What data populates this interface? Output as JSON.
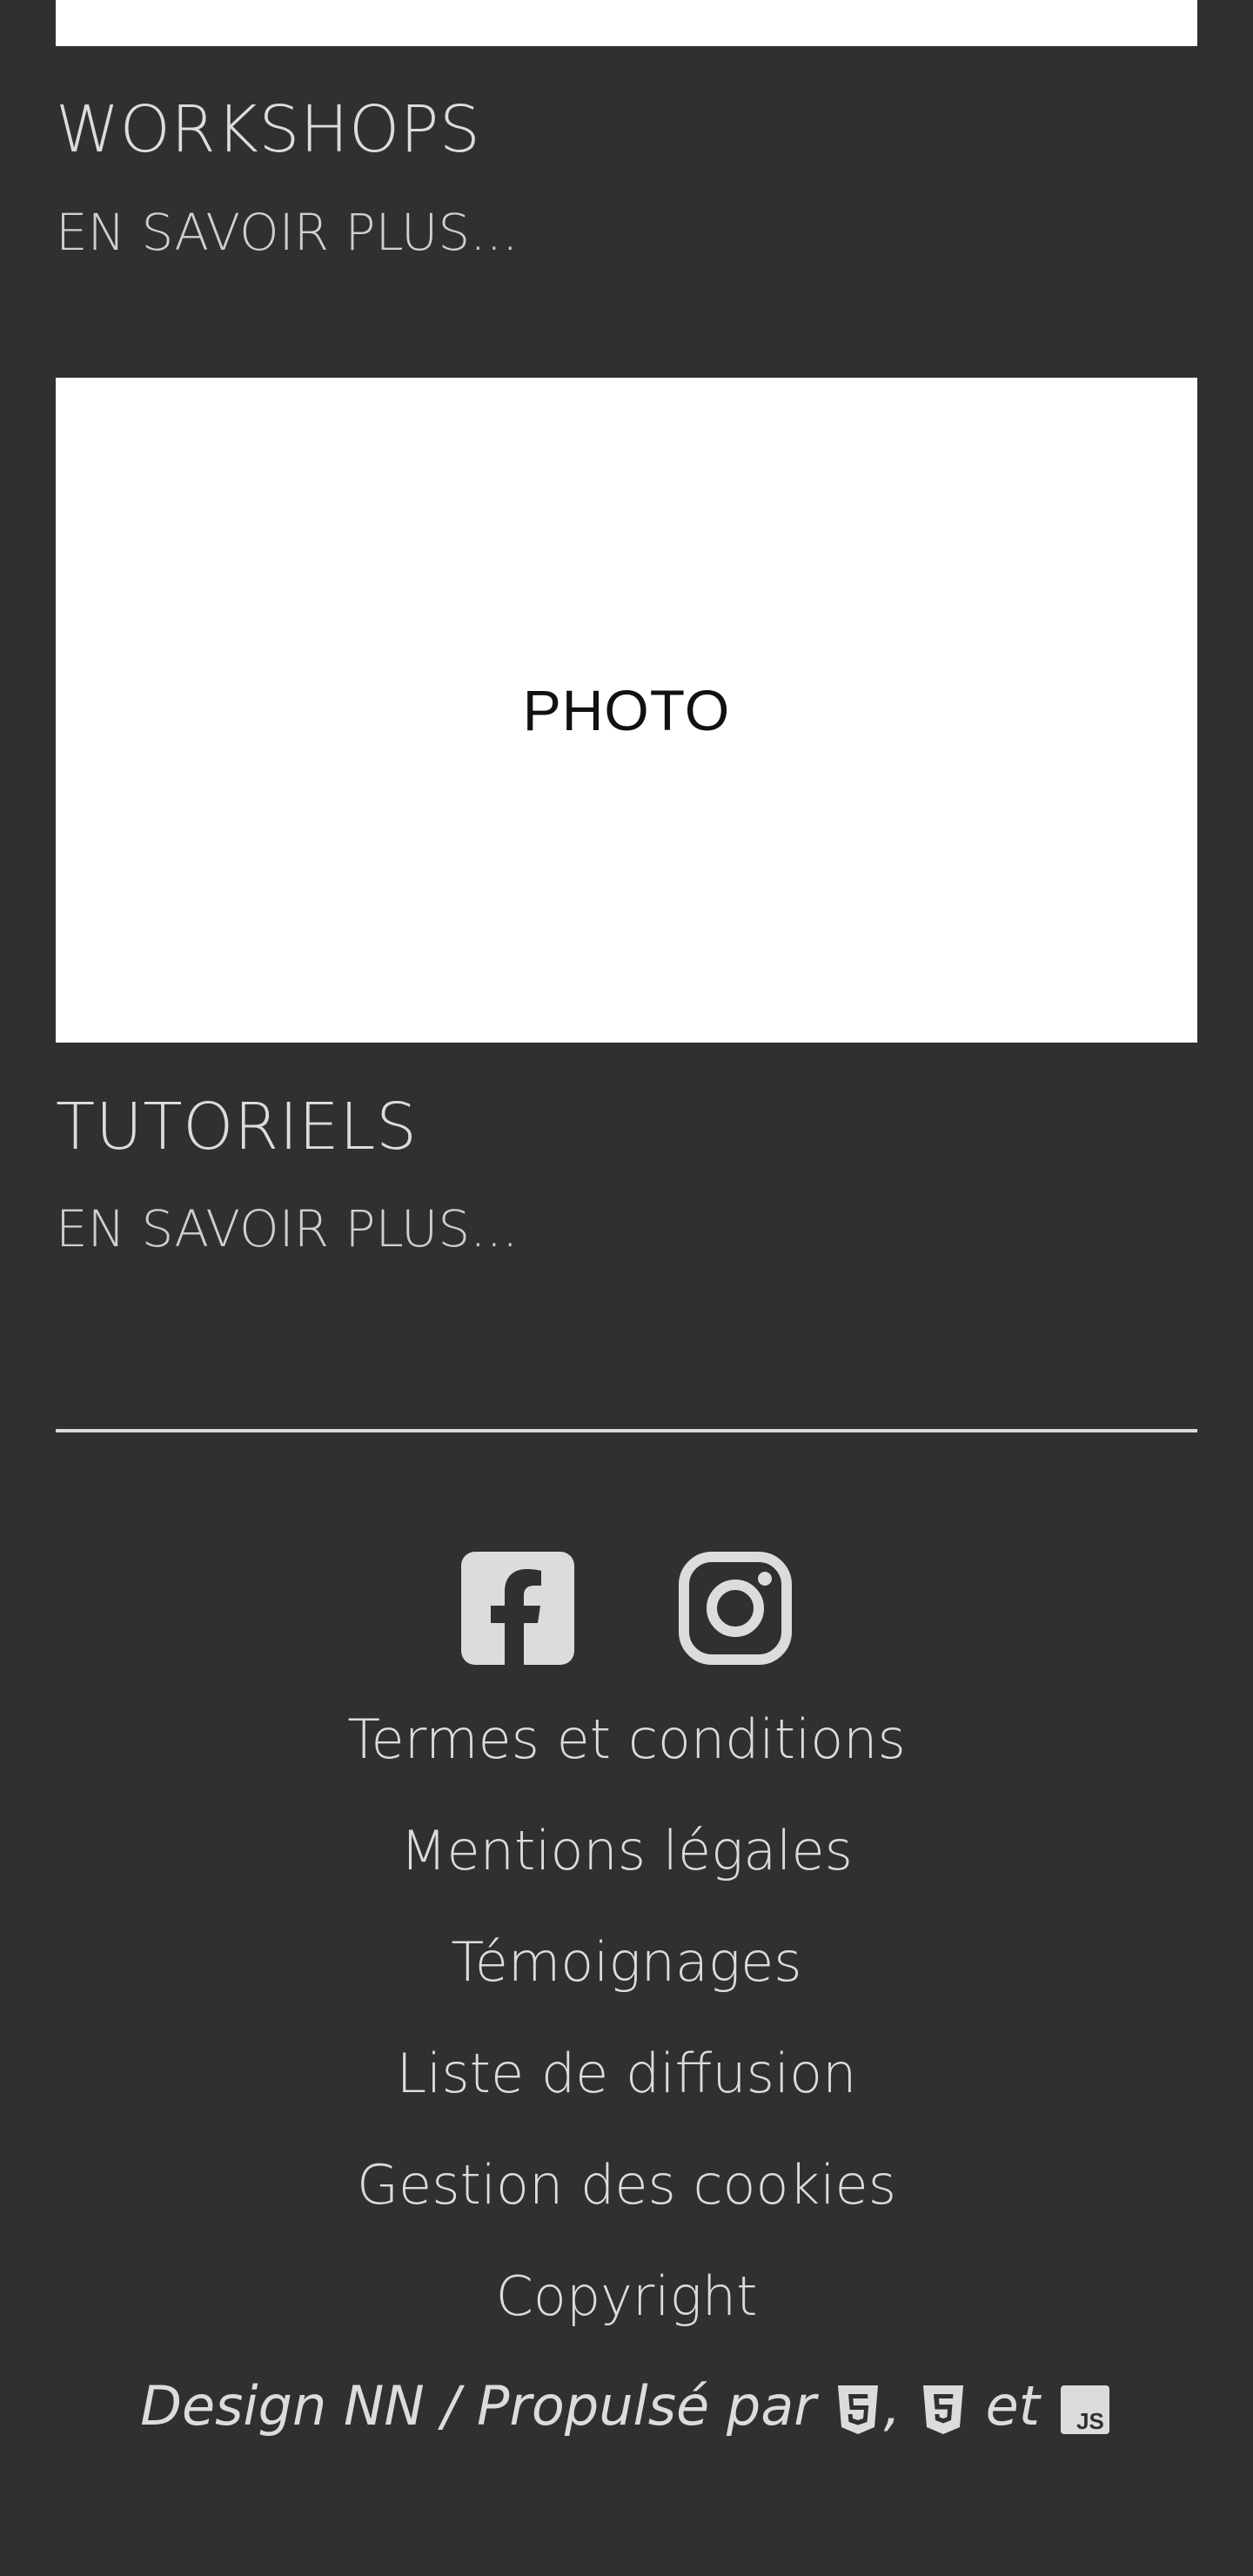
{
  "sections": [
    {
      "title": "WORKSHOPS",
      "more_label": "EN SAVOIR PLUS..."
    },
    {
      "photo_label": "PHOTO",
      "title": "TUTORIELS",
      "more_label": "EN SAVOIR PLUS..."
    }
  ],
  "social": {
    "icons": [
      "facebook-icon",
      "instagram-icon"
    ]
  },
  "footer": {
    "links": [
      "Termes et conditions",
      "Mentions légales",
      "Témoignages",
      "Liste de diffusion",
      "Gestion des cookies",
      "Copyright"
    ],
    "credits_text": "Design NN / Propulsé par",
    "credits_sep": ",",
    "credits_and": "et",
    "badges": [
      "html5-icon",
      "css3-icon",
      "js-icon"
    ]
  },
  "colors": {
    "background": "#303030",
    "text": "#dcdcdc",
    "photo_bg": "#ffffff"
  }
}
